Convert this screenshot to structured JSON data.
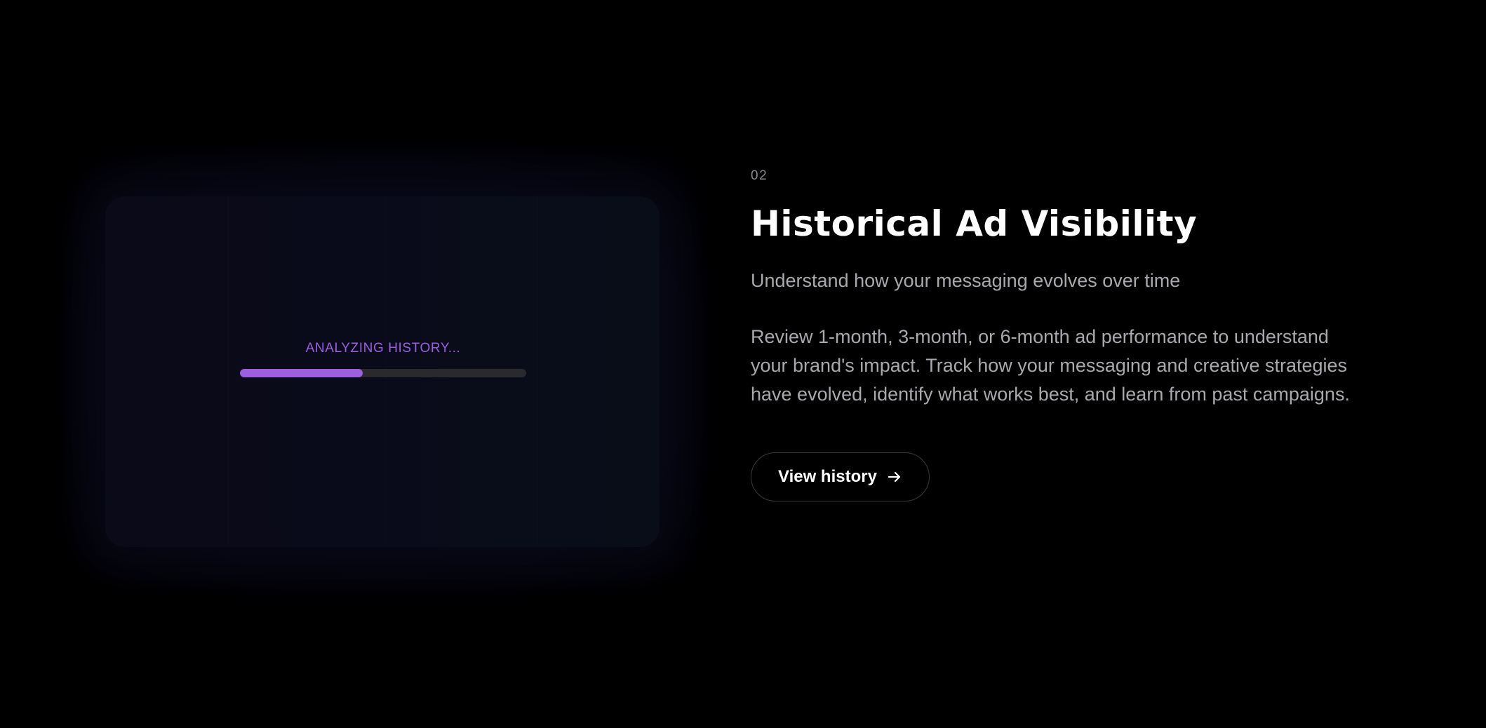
{
  "visual": {
    "loader_label": "ANALYZING HISTORY...",
    "progress_fraction": 0.43,
    "accent_color": "#9b5fe0",
    "track_color": "#2a2a2e"
  },
  "feature": {
    "step_number": "02",
    "title": "Historical Ad Visibility",
    "subtitle": "Understand how your messaging evolves over time",
    "description": "Review 1-month, 3-month, or 6-month ad performance to understand your brand's impact. Track how your messaging and creative strategies have evolved, identify what works best, and learn from past campaigns.",
    "cta_label": "View history",
    "cta_icon": "arrow-right-icon"
  }
}
